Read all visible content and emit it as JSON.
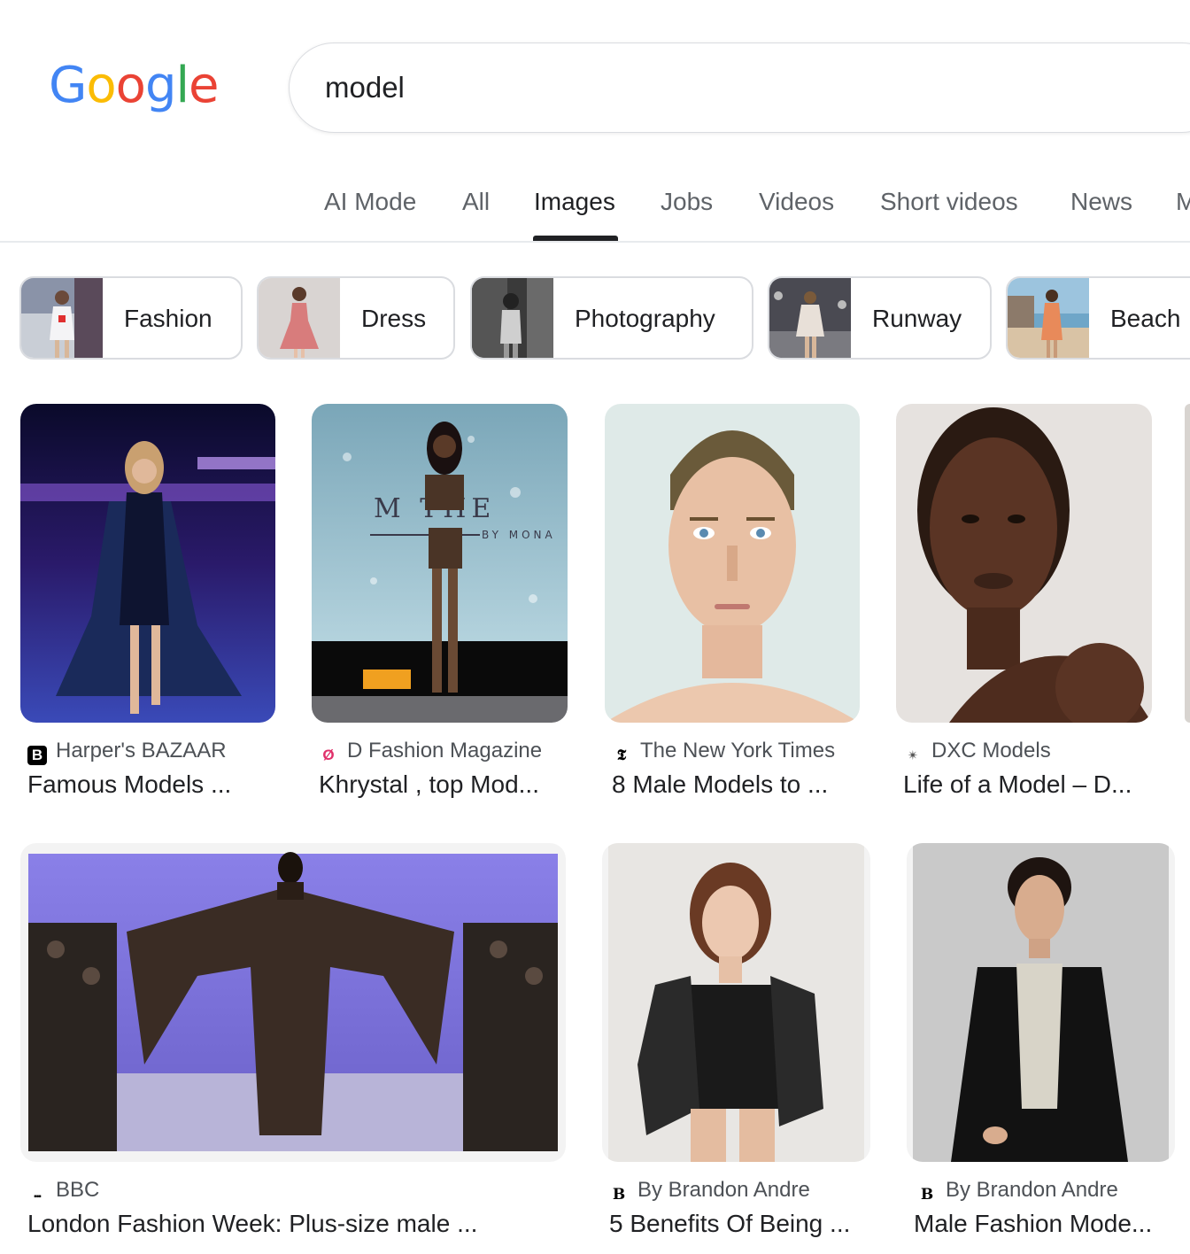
{
  "logo": {
    "letters": [
      "G",
      "o",
      "o",
      "g",
      "l",
      "e"
    ],
    "colors": [
      "#4285f4",
      "#fbbc05",
      "#ea4335",
      "#4285f4",
      "#34a853",
      "#ea4335"
    ]
  },
  "search": {
    "query": "model"
  },
  "tabs": [
    {
      "label": "AI Mode"
    },
    {
      "label": "All"
    },
    {
      "label": "Images",
      "active": true
    },
    {
      "label": "Jobs"
    },
    {
      "label": "Videos"
    },
    {
      "label": "Short videos"
    },
    {
      "label": "News"
    },
    {
      "label": "M"
    }
  ],
  "chips": [
    {
      "label": "Fashion"
    },
    {
      "label": "Dress"
    },
    {
      "label": "Photography"
    },
    {
      "label": "Runway"
    },
    {
      "label": "Beach"
    }
  ],
  "results": [
    {
      "source": "Harper's BAZAAR",
      "favicon": "B",
      "title": "Famous Models ..."
    },
    {
      "source": "D Fashion Magazine",
      "favicon": "Ø",
      "title": "Khrystal , top Mod..."
    },
    {
      "source": "The New York Times",
      "favicon": "𝕿",
      "title": "8 Male Models to ..."
    },
    {
      "source": "DXC Models",
      "favicon": "✴",
      "title": "Life of a Model – D..."
    },
    {
      "source": "BBC",
      "favicon": "▪▪▪",
      "title": "London Fashion Week: Plus-size male ..."
    },
    {
      "source": "By Brandon Andre",
      "favicon": "B",
      "title": "5 Benefits Of Being ..."
    },
    {
      "source": "By Brandon Andre",
      "favicon": "B",
      "title": "Male Fashion Mode..."
    }
  ],
  "image_text": {
    "runway_backdrop": "M THE",
    "runway_backdrop_sub": "BY MONA"
  },
  "colors": {
    "accent": "#202124",
    "muted": "#5f6368",
    "border": "#dadce0"
  }
}
